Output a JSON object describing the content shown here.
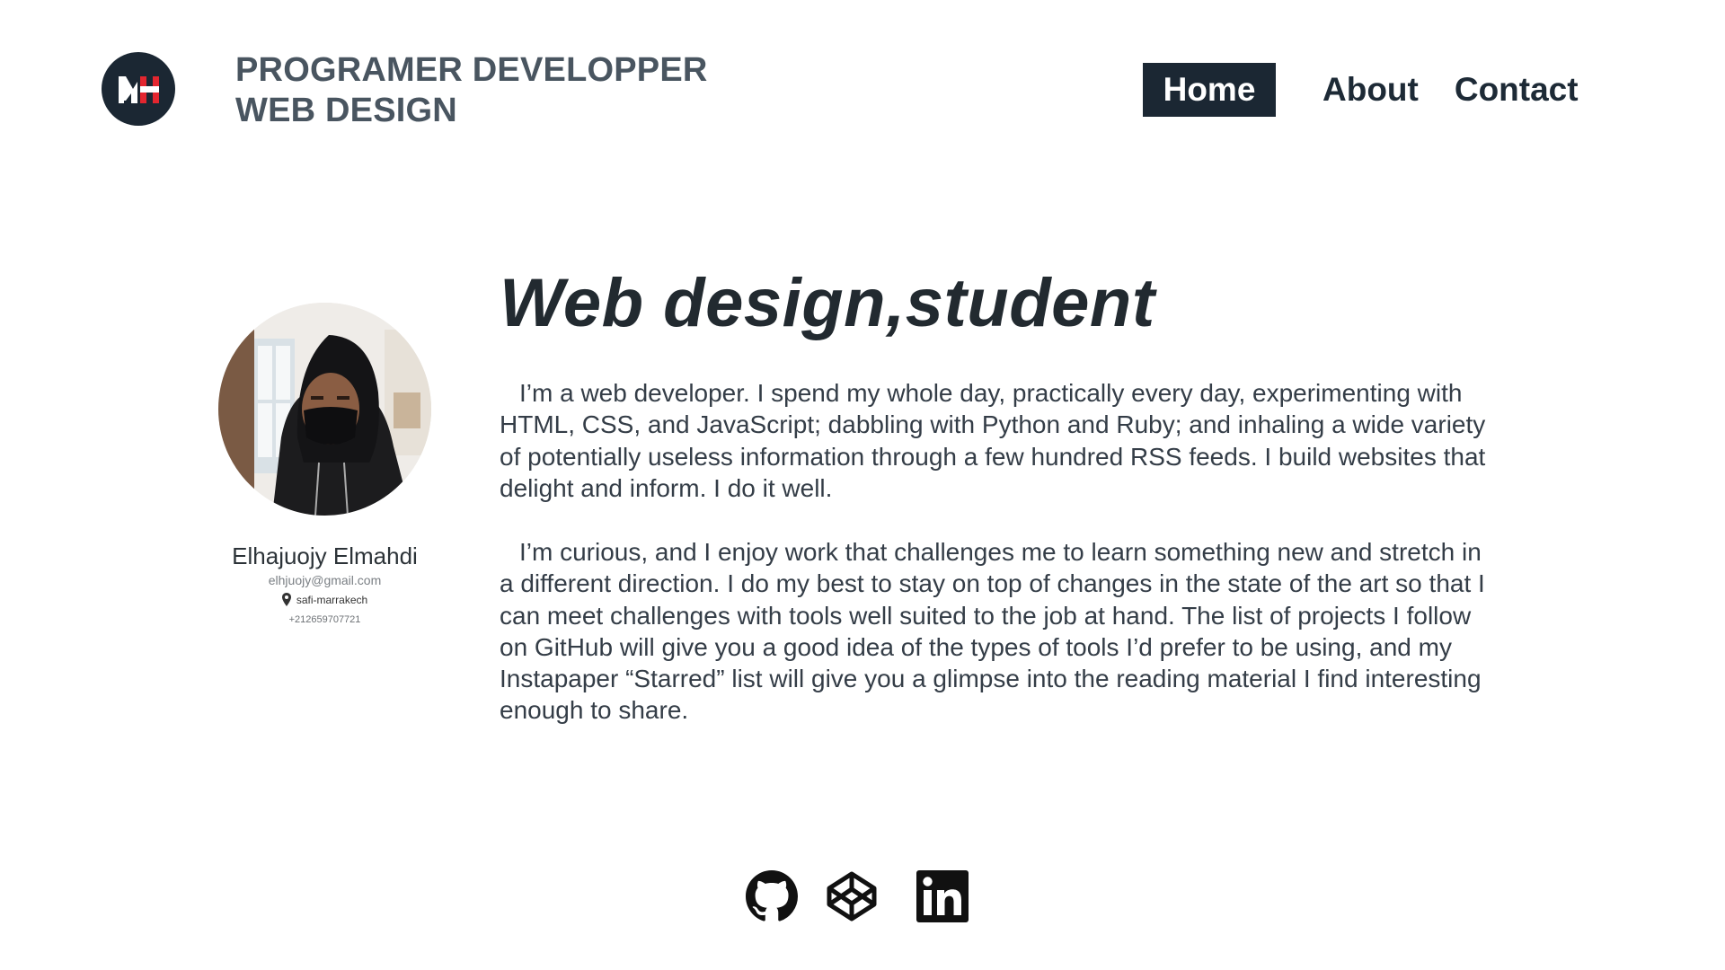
{
  "header": {
    "logo_icon": "mh-monogram-logo-icon",
    "brand_line1": "PROGRAMER DEVELOPPER",
    "brand_line2": "WEB DESIGN",
    "nav": {
      "home": "Home",
      "about": "About",
      "contact": "Contact"
    }
  },
  "profile": {
    "photo_icon": "profile-photo-hooded-person",
    "name": "Elhajuojy Elmahdi",
    "email": "elhjuojy@gmail.com",
    "location_icon": "map-pin-icon",
    "location": "safi-marrakech",
    "phone": "+212659707721"
  },
  "main": {
    "headline": "Web design,student",
    "paragraph1": "I’m a web developer. I spend my whole day, practically every day, experimenting with HTML, CSS, and JavaScript; dabbling with Python and Ruby; and inhaling a wide variety of potentially useless information through a few hundred RSS feeds. I build websites that delight and inform. I do it well.",
    "paragraph2": "I’m curious, and I enjoy work that challenges me to learn something new and stretch in a different direction. I do my best to stay on top of changes in the state of the art so that I can meet challenges with tools well suited to the job at hand. The list of projects I follow on GitHub will give you a good idea of the types of tools I’d prefer to be using, and my Instapaper “Starred” list will give you a glimpse into the reading material I find interesting enough to share."
  },
  "social": [
    "github-icon",
    "codepen-icon",
    "linkedin-icon"
  ],
  "colors": {
    "dark_navy": "#1b2733",
    "logo_red": "#e3262f",
    "text": "#343d47"
  }
}
